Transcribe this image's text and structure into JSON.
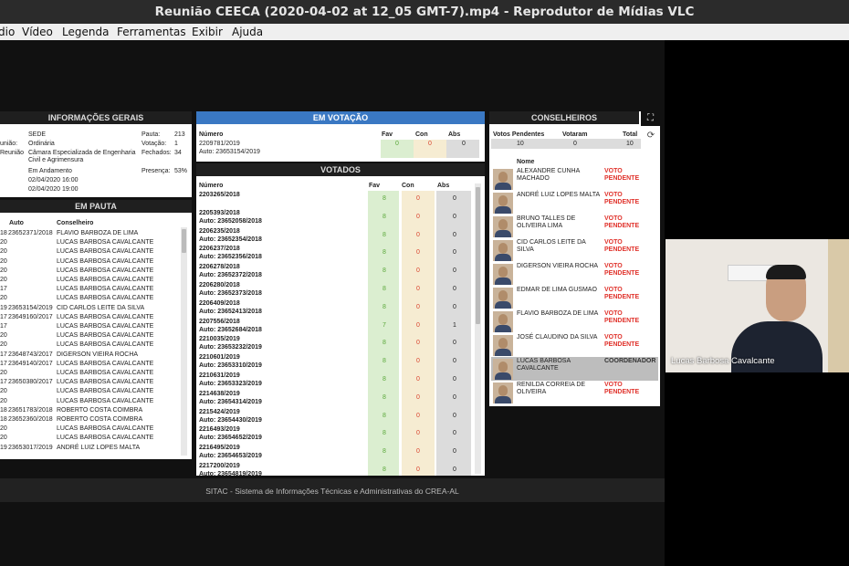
{
  "window": {
    "title": "Reunião CEECA (2020-04-02 at 12_05 GMT-7).mp4 - Reprodutor de Mídias VLC"
  },
  "menu": [
    {
      "label": "dio",
      "underline": "",
      "rest": "dio"
    },
    {
      "label": "Vídeo",
      "underline": "V",
      "rest": "ídeo"
    },
    {
      "label": "Legenda",
      "underline": "",
      "rest": "Legenda"
    },
    {
      "label": "Ferramentas",
      "underline": "",
      "rest": "Ferramentas"
    },
    {
      "label": "Exibir",
      "underline": "",
      "rest": "Exibir"
    },
    {
      "label": "Ajuda",
      "underline": "",
      "rest": "Ajuda"
    }
  ],
  "info_gerais": {
    "header": "INFORMAÇÕES GERAIS",
    "rows": [
      {
        "label": "",
        "value": "SEDE",
        "rlabel": "Pauta:",
        "rvalue": "213"
      },
      {
        "label": "união:",
        "value": "Ordinária",
        "rlabel": "Votação:",
        "rvalue": "1"
      },
      {
        "label": "Reunião",
        "value": "Câmara Especializada de Engenharia Civil e Agrimensura",
        "rlabel": "Fechados:",
        "rvalue": "34"
      },
      {
        "label": "",
        "value": "Em Andamento",
        "rlabel": "Presença:",
        "rvalue": "53%"
      },
      {
        "label": "",
        "value": "02/04/2020 16:00",
        "rlabel": "",
        "rvalue": ""
      },
      {
        "label": "",
        "value": "02/04/2020 19:00",
        "rlabel": "",
        "rvalue": ""
      }
    ]
  },
  "em_pauta": {
    "header": "EM PAUTA",
    "col_auto": "Auto",
    "col_conselheiro": "Conselheiro",
    "rows": [
      {
        "a": "18",
        "b": "23652371/2018",
        "c": "FLAVIO BARBOZA DE LIMA"
      },
      {
        "a": "20",
        "b": "",
        "c": "LUCAS BARBOSA CAVALCANTE"
      },
      {
        "a": "20",
        "b": "",
        "c": "LUCAS BARBOSA CAVALCANTE"
      },
      {
        "a": "20",
        "b": "",
        "c": "LUCAS BARBOSA CAVALCANTE"
      },
      {
        "a": "20",
        "b": "",
        "c": "LUCAS BARBOSA CAVALCANTE"
      },
      {
        "a": "20",
        "b": "",
        "c": "LUCAS BARBOSA CAVALCANTE"
      },
      {
        "a": "17",
        "b": "",
        "c": "LUCAS BARBOSA CAVALCANTE"
      },
      {
        "a": "20",
        "b": "",
        "c": "LUCAS BARBOSA CAVALCANTE"
      },
      {
        "a": "19",
        "b": "23653154/2019",
        "c": "CID CARLOS LEITE DA SILVA"
      },
      {
        "a": "17",
        "b": "23649160/2017",
        "c": "LUCAS BARBOSA CAVALCANTE"
      },
      {
        "a": "17",
        "b": "",
        "c": "LUCAS BARBOSA CAVALCANTE"
      },
      {
        "a": "20",
        "b": "",
        "c": "LUCAS BARBOSA CAVALCANTE"
      },
      {
        "a": "20",
        "b": "",
        "c": "LUCAS BARBOSA CAVALCANTE"
      },
      {
        "a": "17",
        "b": "23648743/2017",
        "c": "DIGERSON VIEIRA ROCHA"
      },
      {
        "a": "17",
        "b": "23649140/2017",
        "c": "LUCAS BARBOSA CAVALCANTE"
      },
      {
        "a": "20",
        "b": "",
        "c": "LUCAS BARBOSA CAVALCANTE"
      },
      {
        "a": "17",
        "b": "23650380/2017",
        "c": "LUCAS BARBOSA CAVALCANTE"
      },
      {
        "a": "20",
        "b": "",
        "c": "LUCAS BARBOSA CAVALCANTE"
      },
      {
        "a": "20",
        "b": "",
        "c": "LUCAS BARBOSA CAVALCANTE"
      },
      {
        "a": "18",
        "b": "23651783/2018",
        "c": "ROBERTO COSTA COIMBRA"
      },
      {
        "a": "18",
        "b": "23652360/2018",
        "c": "ROBERTO COSTA COIMBRA"
      },
      {
        "a": "20",
        "b": "",
        "c": "LUCAS BARBOSA CAVALCANTE"
      },
      {
        "a": "20",
        "b": "",
        "c": "LUCAS BARBOSA CAVALCANTE"
      },
      {
        "a": "19",
        "b": "23653017/2019",
        "c": "ANDRÉ LUIZ LOPES MALTA"
      }
    ]
  },
  "em_votacao": {
    "header": "EM VOTAÇÃO",
    "col_numero": "Número",
    "col_fav": "Fav",
    "col_con": "Con",
    "col_abs": "Abs",
    "numero": "2209781/2019",
    "auto": "Auto: 23653154/2019",
    "fav": "0",
    "con": "0",
    "abs": "0"
  },
  "votados": {
    "header": "VOTADOS",
    "col_numero": "Número",
    "col_fav": "Fav",
    "col_con": "Con",
    "col_abs": "Abs",
    "rows": [
      {
        "n": "2203265/2018",
        "auto": "",
        "fav": "8",
        "con": "0",
        "abs": "0"
      },
      {
        "n": "2205393/2018",
        "auto": "Auto: 23652058/2018",
        "fav": "8",
        "con": "0",
        "abs": "0"
      },
      {
        "n": "2206235/2018",
        "auto": "Auto: 23652354/2018",
        "fav": "8",
        "con": "0",
        "abs": "0"
      },
      {
        "n": "2206237/2018",
        "auto": "Auto: 23652356/2018",
        "fav": "8",
        "con": "0",
        "abs": "0"
      },
      {
        "n": "2206278/2018",
        "auto": "Auto: 23652372/2018",
        "fav": "8",
        "con": "0",
        "abs": "0"
      },
      {
        "n": "2206280/2018",
        "auto": "Auto: 23652373/2018",
        "fav": "8",
        "con": "0",
        "abs": "0"
      },
      {
        "n": "2206409/2018",
        "auto": "Auto: 23652413/2018",
        "fav": "8",
        "con": "0",
        "abs": "0"
      },
      {
        "n": "2207556/2018",
        "auto": "Auto: 23652684/2018",
        "fav": "7",
        "con": "0",
        "abs": "1"
      },
      {
        "n": "2210035/2019",
        "auto": "Auto: 23653232/2019",
        "fav": "8",
        "con": "0",
        "abs": "0"
      },
      {
        "n": "2210601/2019",
        "auto": "Auto: 23653310/2019",
        "fav": "8",
        "con": "0",
        "abs": "0"
      },
      {
        "n": "2210631/2019",
        "auto": "Auto: 23653323/2019",
        "fav": "8",
        "con": "0",
        "abs": "0"
      },
      {
        "n": "2214638/2019",
        "auto": "Auto: 23654314/2019",
        "fav": "8",
        "con": "0",
        "abs": "0"
      },
      {
        "n": "2215424/2019",
        "auto": "Auto: 23654430/2019",
        "fav": "8",
        "con": "0",
        "abs": "0"
      },
      {
        "n": "2216493/2019",
        "auto": "Auto: 23654652/2019",
        "fav": "8",
        "con": "0",
        "abs": "0"
      },
      {
        "n": "2216495/2019",
        "auto": "Auto: 23654653/2019",
        "fav": "8",
        "con": "0",
        "abs": "0"
      },
      {
        "n": "2217200/2019",
        "auto": "Auto: 23654819/2019",
        "fav": "8",
        "con": "0",
        "abs": "0"
      }
    ]
  },
  "conselheiros": {
    "header": "CONSELHEIROS",
    "col_pendentes": "Votos Pendentes",
    "col_votaram": "Votaram",
    "col_total": "Total",
    "pendentes": "10",
    "votaram": "0",
    "total": "10",
    "col_nome": "Nome",
    "members": [
      {
        "name": "ALEXANDRE CUNHA MACHADO",
        "status": "VOTO PENDENTE",
        "status_color": "#e0322b"
      },
      {
        "name": "ANDRÉ LUIZ LOPES MALTA",
        "status": "VOTO PENDENTE",
        "status_color": "#e0322b"
      },
      {
        "name": "BRUNO TALLES DE OLIVEIRA LIMA",
        "status": "VOTO PENDENTE",
        "status_color": "#e0322b"
      },
      {
        "name": "CID CARLOS LEITE DA SILVA",
        "status": "VOTO PENDENTE",
        "status_color": "#e0322b"
      },
      {
        "name": "DIGERSON VIEIRA ROCHA",
        "status": "VOTO PENDENTE",
        "status_color": "#e0322b"
      },
      {
        "name": "EDMAR DE LIMA GUSMAO",
        "status": "VOTO PENDENTE",
        "status_color": "#e0322b"
      },
      {
        "name": "FLAVIO BARBOZA DE LIMA",
        "status": "VOTO PENDENTE",
        "status_color": "#e0322b"
      },
      {
        "name": "JOSÉ CLAUDINO DA SILVA",
        "status": "VOTO PENDENTE",
        "status_color": "#e0322b"
      },
      {
        "name": "LUCAS BARBOSA CAVALCANTE",
        "status": "COORDENADOR",
        "status_color": "#333333"
      },
      {
        "name": "RENILDA CORREIA DE OLIVEIRA",
        "status": "VOTO PENDENTE",
        "status_color": "#e0322b"
      }
    ]
  },
  "footer": "SITAC - Sistema de Informações Técnicas e Administrativas do CREA-AL",
  "webcam": {
    "name": "Lucas Barbosa Cavalcante"
  }
}
